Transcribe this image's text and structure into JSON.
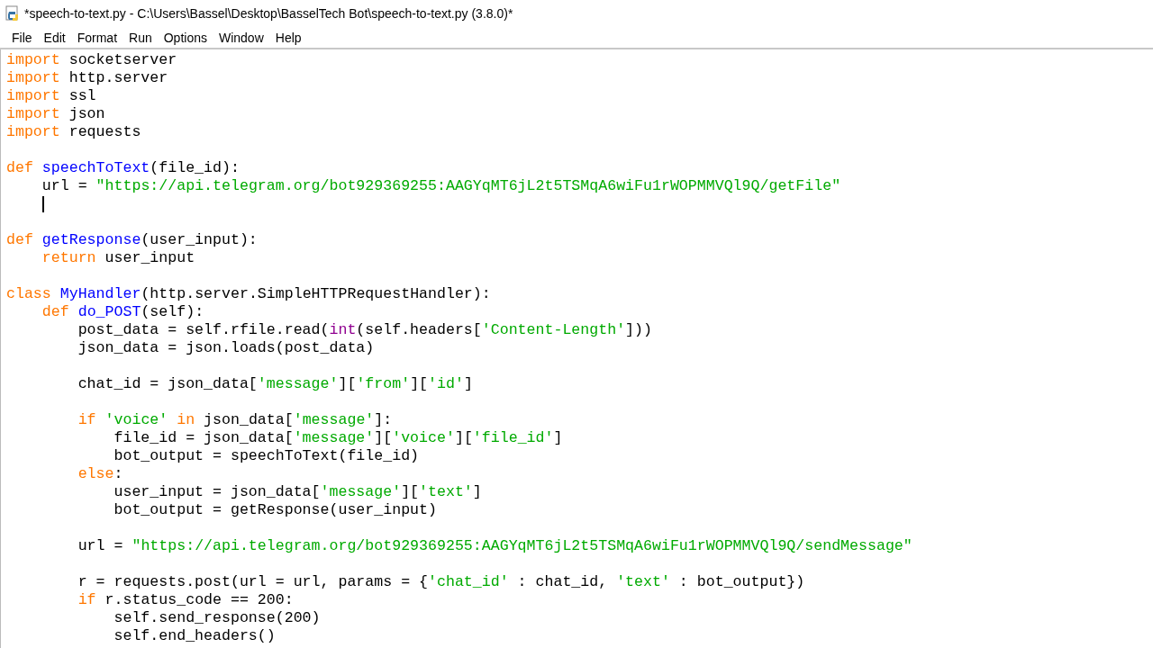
{
  "window": {
    "title": "*speech-to-text.py - C:\\Users\\Bassel\\Desktop\\BasselTech Bot\\speech-to-text.py (3.8.0)*"
  },
  "menu": [
    "File",
    "Edit",
    "Format",
    "Run",
    "Options",
    "Window",
    "Help"
  ],
  "editor": {
    "lines": [
      {
        "caret": false,
        "tokens": [
          {
            "kind": "kw",
            "text": "import"
          },
          {
            "kind": "p",
            "text": " socketserver"
          }
        ]
      },
      {
        "caret": false,
        "tokens": [
          {
            "kind": "kw",
            "text": "import"
          },
          {
            "kind": "p",
            "text": " http.server"
          }
        ]
      },
      {
        "caret": false,
        "tokens": [
          {
            "kind": "kw",
            "text": "import"
          },
          {
            "kind": "p",
            "text": " ssl"
          }
        ]
      },
      {
        "caret": false,
        "tokens": [
          {
            "kind": "kw",
            "text": "import"
          },
          {
            "kind": "p",
            "text": " json"
          }
        ]
      },
      {
        "caret": false,
        "tokens": [
          {
            "kind": "kw",
            "text": "import"
          },
          {
            "kind": "p",
            "text": " requests"
          }
        ]
      },
      {
        "caret": false
      },
      {
        "caret": false,
        "tokens": [
          {
            "kind": "kw",
            "text": "def"
          },
          {
            "kind": "def",
            "text": " speechToText"
          },
          {
            "kind": "p",
            "text": "(file_id):"
          }
        ]
      },
      {
        "caret": false,
        "tokens": [
          {
            "kind": "p",
            "text": "    url = "
          },
          {
            "kind": "str",
            "text": "\"https://api.telegram.org/bot929369255:AAGYqMT6jL2t5TSMqA6wiFu1rWOPMMVQl9Q/getFile\""
          }
        ]
      },
      {
        "caret": true
      },
      {
        "caret": false
      },
      {
        "caret": false,
        "tokens": [
          {
            "kind": "kw",
            "text": "def"
          },
          {
            "kind": "def",
            "text": " getResponse"
          },
          {
            "kind": "p",
            "text": "(user_input):"
          }
        ]
      },
      {
        "caret": false,
        "tokens": [
          {
            "kind": "kw",
            "text": "    return"
          },
          {
            "kind": "p",
            "text": " user_input"
          }
        ]
      },
      {
        "caret": false
      },
      {
        "caret": false,
        "tokens": [
          {
            "kind": "kw",
            "text": "class"
          },
          {
            "kind": "def",
            "text": " MyHandler"
          },
          {
            "kind": "p",
            "text": "(http.server.SimpleHTTPRequestHandler):"
          }
        ]
      },
      {
        "caret": false,
        "tokens": [
          {
            "kind": "kw",
            "text": "    def"
          },
          {
            "kind": "def",
            "text": " do_POST"
          },
          {
            "kind": "p",
            "text": "(self):"
          }
        ]
      },
      {
        "caret": false,
        "tokens": [
          {
            "kind": "p",
            "text": "        post_data = self.rfile.read("
          },
          {
            "kind": "bi",
            "text": "int"
          },
          {
            "kind": "p",
            "text": "(self.headers["
          },
          {
            "kind": "str",
            "text": "'Content-Length'"
          },
          {
            "kind": "p",
            "text": "]))"
          }
        ]
      },
      {
        "caret": false,
        "tokens": [
          {
            "kind": "p",
            "text": "        json_data = json.loads(post_data)"
          }
        ]
      },
      {
        "caret": false
      },
      {
        "caret": false,
        "tokens": [
          {
            "kind": "p",
            "text": "        chat_id = json_data["
          },
          {
            "kind": "str",
            "text": "'message'"
          },
          {
            "kind": "p",
            "text": "]["
          },
          {
            "kind": "str",
            "text": "'from'"
          },
          {
            "kind": "p",
            "text": "]["
          },
          {
            "kind": "str",
            "text": "'id'"
          },
          {
            "kind": "p",
            "text": "]"
          }
        ]
      },
      {
        "caret": false
      },
      {
        "caret": false,
        "tokens": [
          {
            "kind": "kw",
            "text": "        if"
          },
          {
            "kind": "str",
            "text": " 'voice'"
          },
          {
            "kind": "kw",
            "text": " in"
          },
          {
            "kind": "p",
            "text": " json_data["
          },
          {
            "kind": "str",
            "text": "'message'"
          },
          {
            "kind": "p",
            "text": "]:"
          }
        ]
      },
      {
        "caret": false,
        "tokens": [
          {
            "kind": "p",
            "text": "            file_id = json_data["
          },
          {
            "kind": "str",
            "text": "'message'"
          },
          {
            "kind": "p",
            "text": "]["
          },
          {
            "kind": "str",
            "text": "'voice'"
          },
          {
            "kind": "p",
            "text": "]["
          },
          {
            "kind": "str",
            "text": "'file_id'"
          },
          {
            "kind": "p",
            "text": "]"
          }
        ]
      },
      {
        "caret": false,
        "tokens": [
          {
            "kind": "p",
            "text": "            bot_output = speechToText(file_id)"
          }
        ]
      },
      {
        "caret": false,
        "tokens": [
          {
            "kind": "kw",
            "text": "        else"
          },
          {
            "kind": "p",
            "text": ":"
          }
        ]
      },
      {
        "caret": false,
        "tokens": [
          {
            "kind": "p",
            "text": "            user_input = json_data["
          },
          {
            "kind": "str",
            "text": "'message'"
          },
          {
            "kind": "p",
            "text": "]["
          },
          {
            "kind": "str",
            "text": "'text'"
          },
          {
            "kind": "p",
            "text": "]"
          }
        ]
      },
      {
        "caret": false,
        "tokens": [
          {
            "kind": "p",
            "text": "            bot_output = getResponse(user_input)"
          }
        ]
      },
      {
        "caret": false
      },
      {
        "caret": false,
        "tokens": [
          {
            "kind": "p",
            "text": "        url = "
          },
          {
            "kind": "str",
            "text": "\"https://api.telegram.org/bot929369255:AAGYqMT6jL2t5TSMqA6wiFu1rWOPMMVQl9Q/sendMessage\""
          }
        ]
      },
      {
        "caret": false
      },
      {
        "caret": false,
        "tokens": [
          {
            "kind": "p",
            "text": "        r = requests.post(url = url, params = {"
          },
          {
            "kind": "str",
            "text": "'chat_id'"
          },
          {
            "kind": "p",
            "text": " : chat_id, "
          },
          {
            "kind": "str",
            "text": "'text'"
          },
          {
            "kind": "p",
            "text": " : bot_output})"
          }
        ]
      },
      {
        "caret": false,
        "tokens": [
          {
            "kind": "kw",
            "text": "        if"
          },
          {
            "kind": "p",
            "text": " r.status_code == 200:"
          }
        ]
      },
      {
        "caret": false,
        "tokens": [
          {
            "kind": "p",
            "text": "            self.send_response(200)"
          }
        ]
      },
      {
        "caret": false,
        "tokens": [
          {
            "kind": "p",
            "text": "            self.end_headers()"
          }
        ]
      }
    ]
  }
}
